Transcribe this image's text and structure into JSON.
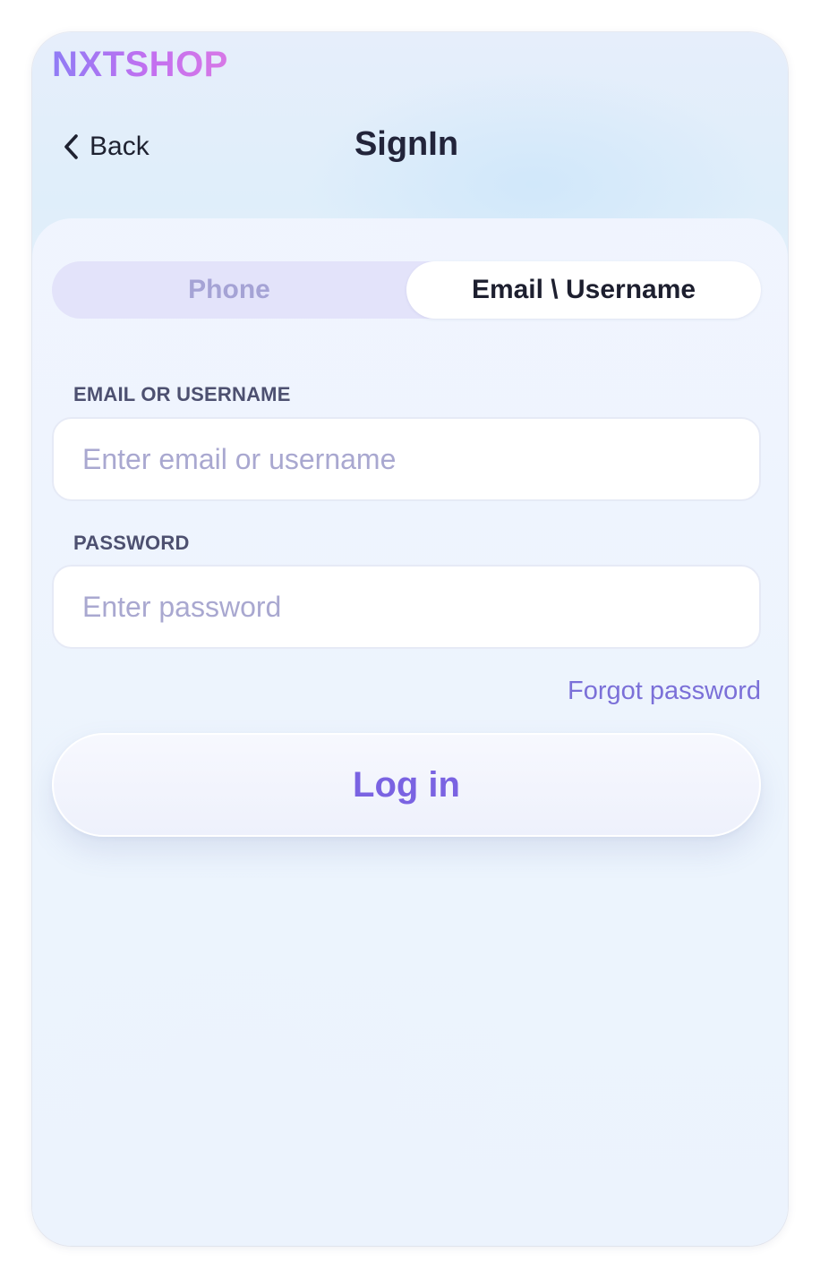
{
  "brand": {
    "logo_text": "NXTSHOP"
  },
  "nav": {
    "back_label": "Back",
    "title": "SignIn"
  },
  "tabs": [
    {
      "label": "Phone",
      "selected": false
    },
    {
      "label": "Email \\ Username",
      "selected": true
    }
  ],
  "form": {
    "email": {
      "label": "EMAIL OR USERNAME",
      "placeholder": "Enter email or username",
      "value": ""
    },
    "password": {
      "label": "PASSWORD",
      "placeholder": "Enter password",
      "value": ""
    },
    "forgot_label": "Forgot password",
    "login_label": "Log in"
  },
  "icons": {
    "back": "chevron-left-icon"
  },
  "colors": {
    "accent": "#7a63e2",
    "link": "#7b70d8",
    "tab_track": "#e3e3fa",
    "inactive_tab_text": "#a5a3d5",
    "title_text": "#22243a"
  }
}
